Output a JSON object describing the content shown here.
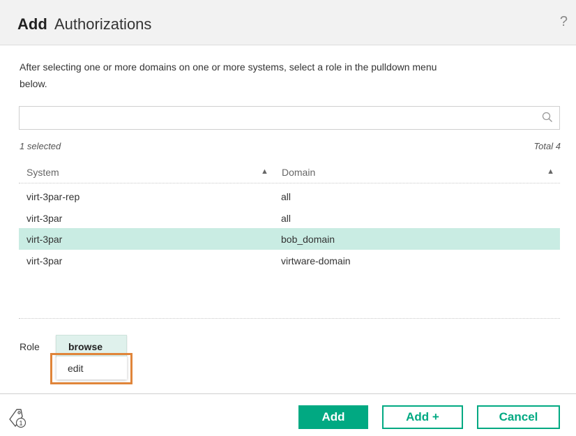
{
  "header": {
    "title_bold": "Add",
    "title_rest": "Authorizations",
    "help_label": "?"
  },
  "description": "After selecting one or more domains on one or more systems, select a role in the pulldown menu below.",
  "search": {
    "value": "",
    "placeholder": "",
    "icon": "search-icon"
  },
  "summary": {
    "selected": "1 selected",
    "total": "Total 4"
  },
  "table": {
    "columns": [
      {
        "label": "System",
        "sort": "▲"
      },
      {
        "label": "Domain",
        "sort": "▲"
      }
    ],
    "rows": [
      {
        "system": "virt-3par-rep",
        "domain": "all",
        "selected": false
      },
      {
        "system": "virt-3par",
        "domain": "all",
        "selected": false
      },
      {
        "system": "virt-3par",
        "domain": "bob_domain",
        "selected": true
      },
      {
        "system": "virt-3par",
        "domain": "virtware-domain",
        "selected": false
      }
    ]
  },
  "role": {
    "label": "Role",
    "selected": "browse",
    "options_visible": [
      "edit"
    ]
  },
  "footer": {
    "tag_badge": "1",
    "add_label": "Add",
    "add_plus_label": "Add +",
    "cancel_label": "Cancel"
  },
  "colors": {
    "accent": "#01a982",
    "selected_row": "#c9ece3",
    "highlight": "#e0853a"
  }
}
